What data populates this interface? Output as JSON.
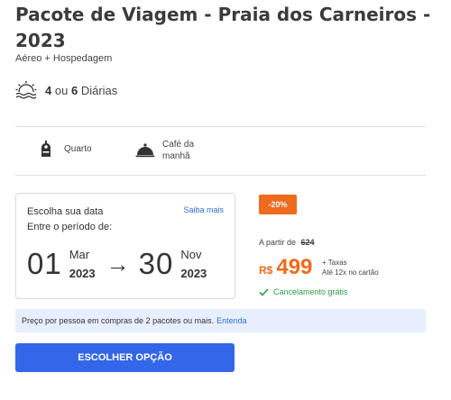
{
  "package": {
    "title": "Pacote de Viagem - Praia dos Carneiros - 2023",
    "subtitle": "Aéreo + Hospedagem"
  },
  "days": {
    "min": "4",
    "connector": "ou",
    "max": "6",
    "unit": "Diárias",
    "icon": "sunset-icon"
  },
  "amenities": [
    {
      "icon": "door-hanger-icon",
      "label": "Quarto"
    },
    {
      "icon": "cloche-icon",
      "label": "Café da manhã"
    }
  ],
  "date_picker": {
    "heading": "Escolha sua data",
    "link": "Saiba mais",
    "period_label": "Entre o período de:",
    "start": {
      "day": "01",
      "month": "Mar",
      "year": "2023"
    },
    "end": {
      "day": "30",
      "month": "Nov",
      "year": "2023"
    },
    "arrow": "→"
  },
  "pricing": {
    "discount_badge": "-20%",
    "from_label": "A partir de",
    "old_price": "624",
    "currency": "R$",
    "price": "499",
    "taxes": "+ Taxas",
    "installments": "Até 12x no cartão",
    "cancellation": "Cancelamento grátis"
  },
  "info_bar": {
    "text": "Preço por pessoa em compras de 2 pacotes ou mais.",
    "link": "Entenda"
  },
  "cta": {
    "label": "ESCOLHER OPÇÃO"
  },
  "colors": {
    "accent_orange": "#ef6a1c",
    "primary_blue": "#3366e8",
    "link_blue": "#2f6fd6",
    "success_green": "#2e9d48",
    "info_bg": "#e7efff"
  }
}
